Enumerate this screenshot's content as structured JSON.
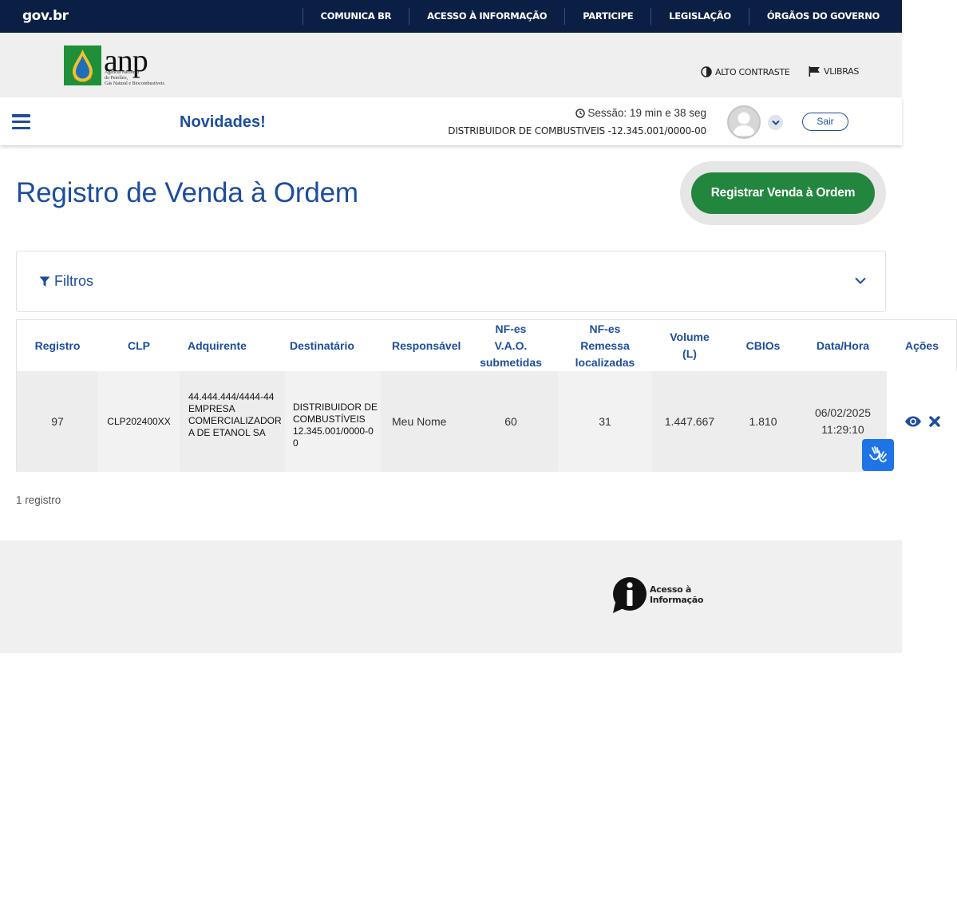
{
  "govbar": {
    "logo": "gov.br",
    "links": [
      "COMUNICA BR",
      "ACESSO À INFORMAÇÃO",
      "PARTICIPE",
      "LEGISLAÇÃO",
      "ÓRGÃOS DO GOVERNO"
    ]
  },
  "header": {
    "logo_word": "anp",
    "logo_sub_1": "Agência Nacional",
    "logo_sub_2": "do Petróleo,",
    "logo_sub_3": "Gás Natural e Biocombustíveis",
    "alto_contraste": "ALTO CONTRASTE",
    "vlibras": "VLIBRAS"
  },
  "subbar": {
    "novidades": "Novidades!",
    "sessao": "Sessão: 19 min e 38 seg",
    "distribuidor": "DISTRIBUIDOR DE COMBUSTIVEIS -12.345.001/0000-00",
    "sair": "Sair"
  },
  "page": {
    "title": "Registro de Venda à Ordem",
    "register_button": "Registrar Venda à Ordem",
    "filtros": "Filtros",
    "count": "1 registro"
  },
  "table": {
    "headers": {
      "registro": "Registro",
      "clp": "CLP",
      "adquirente": "Adquirente",
      "destinatario": "Destinatário",
      "responsavel": "Responsável",
      "nfes_vao_1": "NF-es",
      "nfes_vao_2": "V.A.O.",
      "nfes_vao_3": "submetidas",
      "nfes_rem_1": "NF-es",
      "nfes_rem_2": "Remessa",
      "nfes_rem_3": "localizadas",
      "volume_1": "Volume",
      "volume_2": "(L)",
      "cbios": "CBIOs",
      "datahora": "Data/Hora",
      "acoes": "Ações"
    },
    "rows": [
      {
        "registro": "97",
        "clp": "CLP202400XX",
        "adquirente": "44.444.444/4444-44 EMPRESA COMERCIALIZADOR A DE ETANOL SA",
        "destinatario": "DISTRIBUIDOR DE COMBUSTÍVEIS 12.345.001/0000-0 0",
        "responsavel": "Meu  Nome",
        "nfes_vao": "60",
        "nfes_rem": "31",
        "volume": "1.447.667",
        "cbios": "1.810",
        "data": "06/02/2025",
        "hora": "11:29:10"
      }
    ]
  },
  "footer": {
    "acesso_1": "Acesso à",
    "acesso_2": "Informação"
  },
  "colors": {
    "primary_blue": "#1c4d9e",
    "gov_navy": "#0b1f45",
    "register_green": "#23863e",
    "libras_blue": "#1e74e6"
  }
}
